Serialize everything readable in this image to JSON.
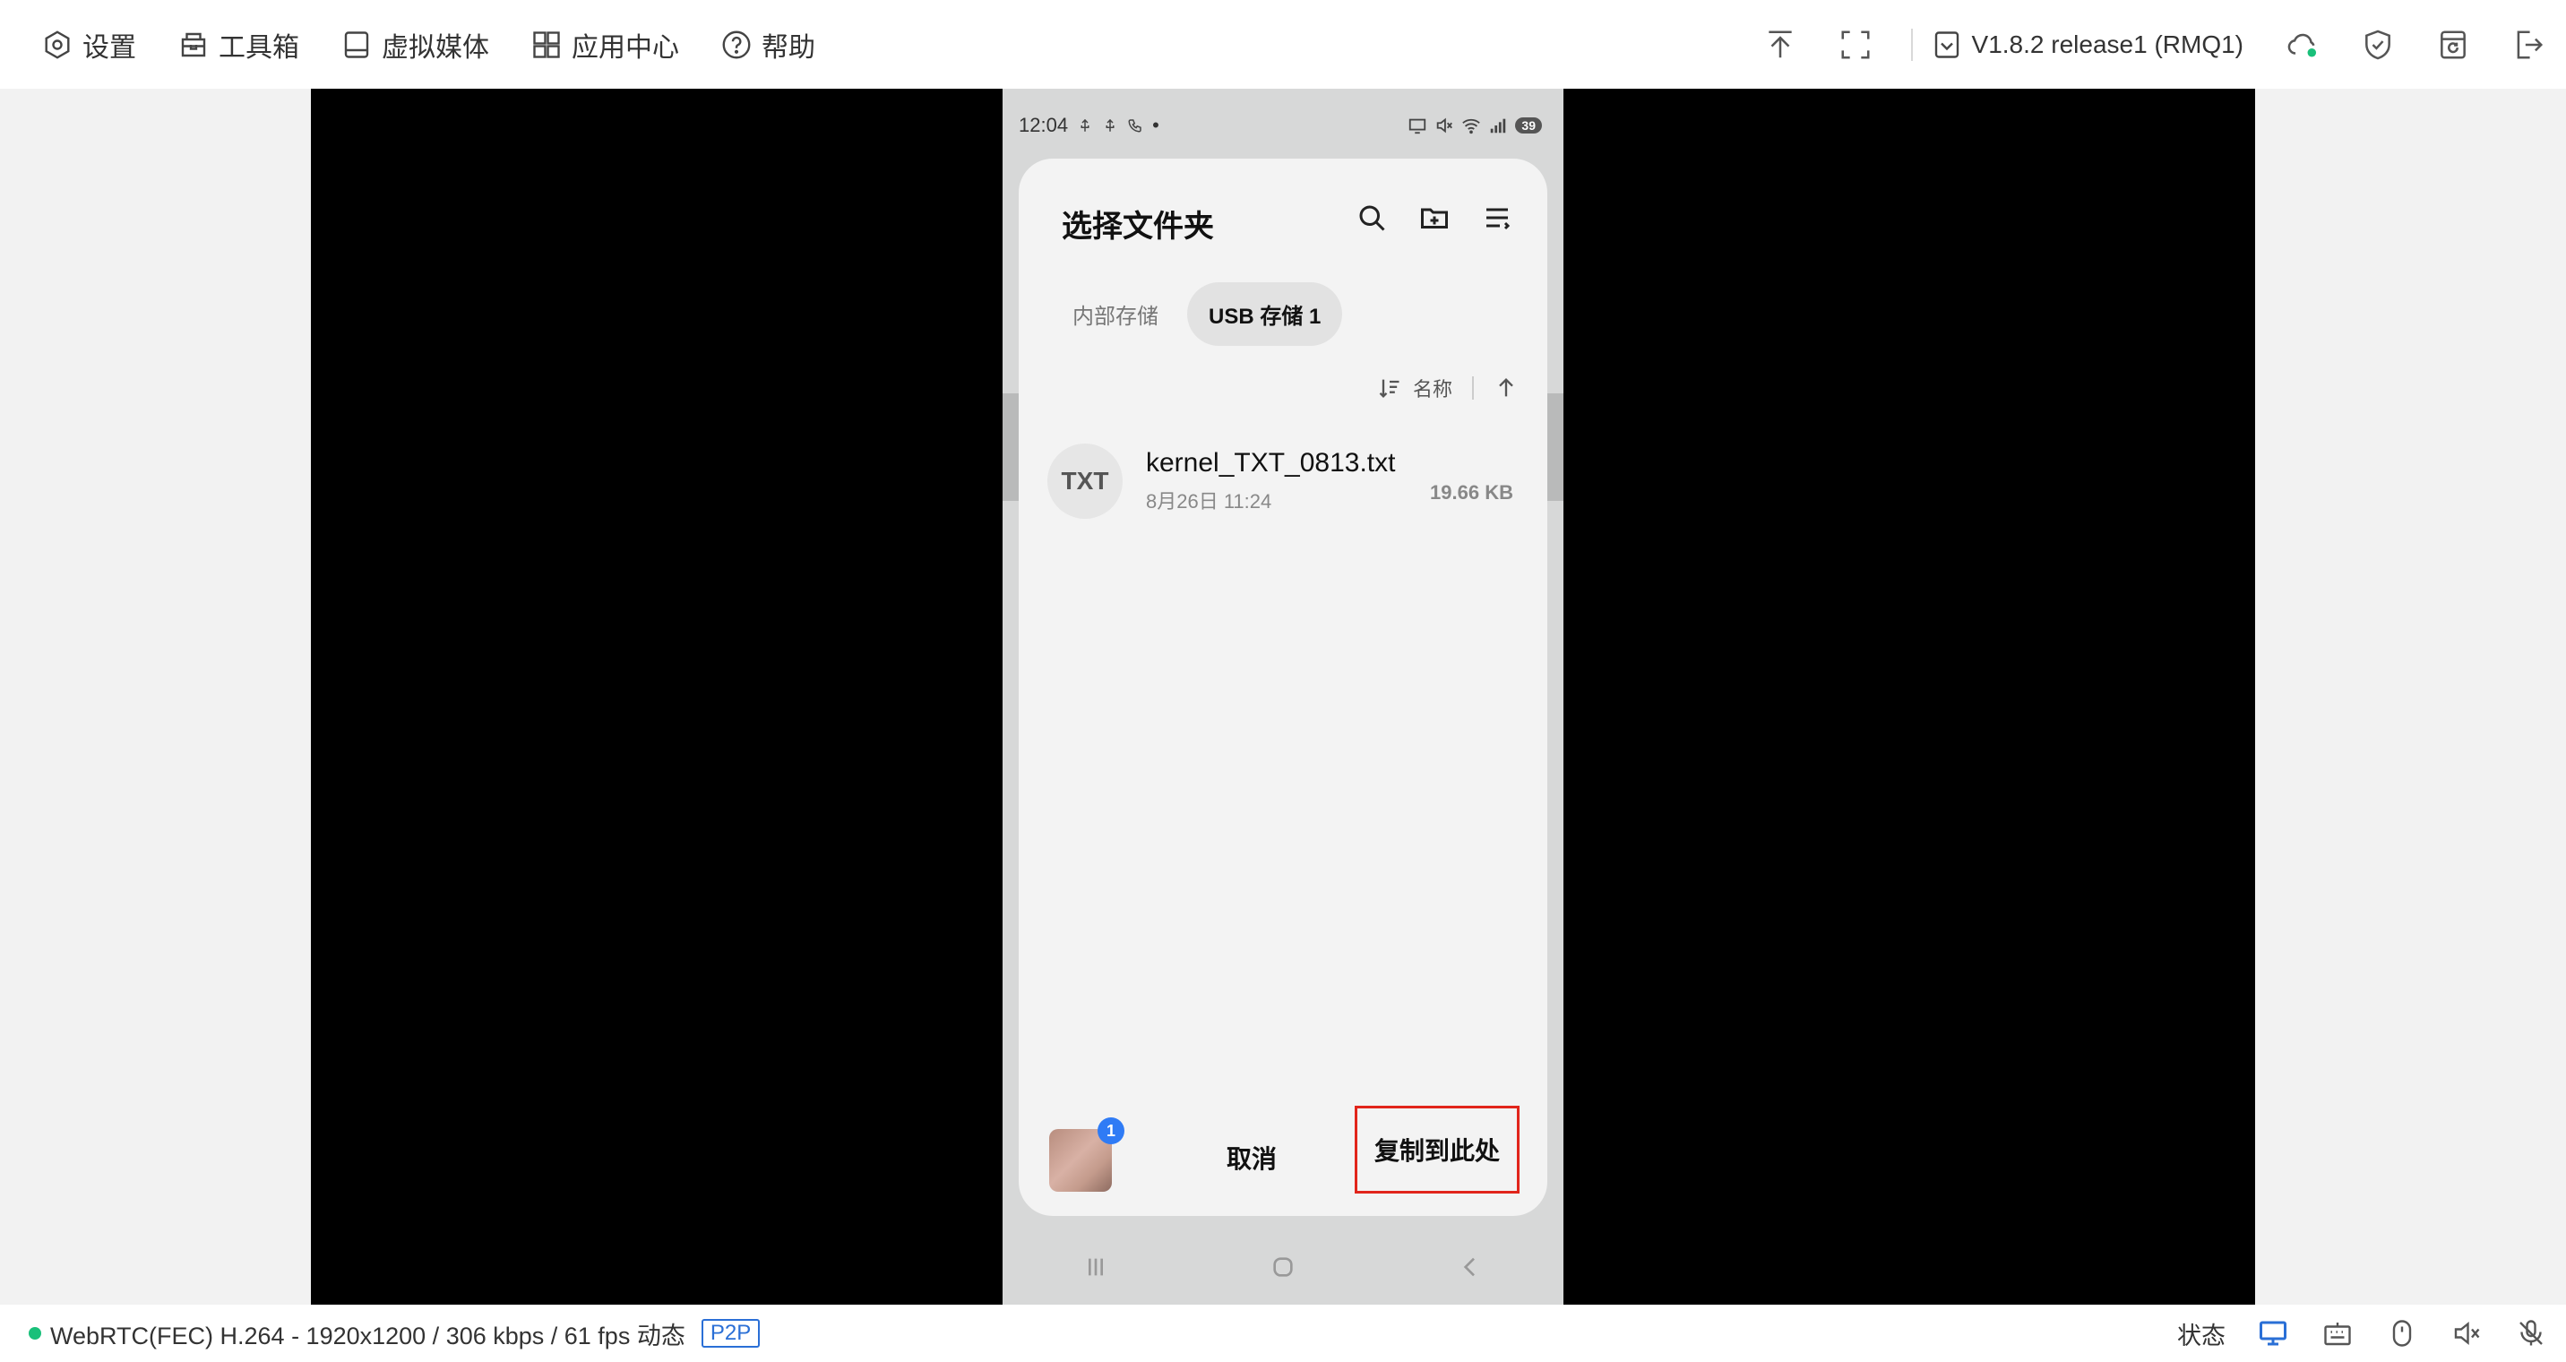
{
  "toolbar": {
    "menu": [
      {
        "label": "设置",
        "icon": "settings-icon"
      },
      {
        "label": "工具箱",
        "icon": "toolbox-icon"
      },
      {
        "label": "虚拟媒体",
        "icon": "virtual-media-icon"
      },
      {
        "label": "应用中心",
        "icon": "app-center-icon"
      },
      {
        "label": "帮助",
        "icon": "help-icon"
      }
    ],
    "version": "V1.8.2 release1 (RMQ1)"
  },
  "phone": {
    "status_time": "12:04",
    "battery": "39",
    "dialog": {
      "title": "选择文件夹",
      "tabs": [
        {
          "label": "内部存储",
          "active": false
        },
        {
          "label": "USB 存储 1",
          "active": true
        }
      ],
      "sort_label": "名称",
      "files": [
        {
          "type_label": "TXT",
          "name": "kernel_TXT_0813.txt",
          "date": "8月26日 11:24",
          "size": "19.66 KB"
        }
      ],
      "thumb_badge": "1",
      "cancel_label": "取消",
      "copy_label": "复制到此处"
    }
  },
  "bottombar": {
    "stream_info": "WebRTC(FEC) H.264 - 1920x1200 /  306 kbps / 61 fps 动态",
    "p2p_badge": "P2P",
    "status_label": "状态",
    "status_color": "#19c07a",
    "accent_color": "#2a6fd6",
    "highlight_color": "#e1251b"
  }
}
